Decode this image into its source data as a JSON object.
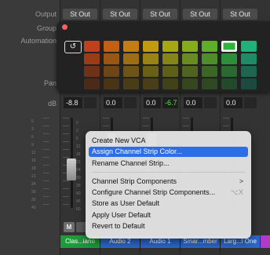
{
  "labels": {
    "output": "Output",
    "group": "Group",
    "automation": "Automation",
    "pan": "Pan",
    "db": "dB"
  },
  "strips": [
    {
      "output": "St Out",
      "db": "-8.8",
      "db2": "",
      "name": "Clas...iano",
      "color": "#1f9a3a",
      "mute": "M",
      "solo": ""
    },
    {
      "output": "St Out",
      "db": "0.0",
      "db2": "",
      "name": "Audio 2",
      "color": "#2c67c9"
    },
    {
      "output": "St Out",
      "db": "0.0",
      "db2": "-6.7",
      "name": "Audio 1",
      "color": "#2c67c9"
    },
    {
      "output": "St Out",
      "db": "0.0",
      "db2": "",
      "name": "Smar...mber",
      "color": "#2c67c9"
    },
    {
      "output": "St Out",
      "db": "0.0",
      "db2": "",
      "name": "Larg...l One",
      "color": "#2c67c9"
    }
  ],
  "palette": {
    "undo_icon": "↺",
    "rows": [
      [
        "#c0401c",
        "#c35e12",
        "#c57d12",
        "#c19a10",
        "#a6a712",
        "#87ac1c",
        "#5fae2a",
        "#2fb33a",
        "#1fb27a"
      ],
      [
        "#9a3c18",
        "#9c5612",
        "#9c6f14",
        "#978414",
        "#84861a",
        "#6a8a22",
        "#4f8c2c",
        "#2e8f3a",
        "#1f8c68"
      ],
      [
        "#6e3218",
        "#6e4514",
        "#6e5416",
        "#6a5f16",
        "#5e601a",
        "#4e6420",
        "#3c6626",
        "#2a6a32",
        "#1e6650"
      ],
      [
        "#4a2a18",
        "#4a3416",
        "#4a3c18",
        "#483f18",
        "#40421a",
        "#36461e",
        "#2e4822",
        "#24482a",
        "#1c4a3e"
      ]
    ],
    "selected": {
      "row": 0,
      "col": 7
    }
  },
  "menu": {
    "items": [
      {
        "label": "Create New VCA"
      },
      {
        "label": "Assign Channel Strip Color...",
        "highlighted": true
      },
      {
        "label": "Rename Channel Strip..."
      },
      {
        "label": "Channel Strip Components",
        "shortcut": ">"
      },
      {
        "label": "Configure Channel Strip Components...",
        "shortcut": "⌥X"
      },
      {
        "label": "Store as User Default"
      },
      {
        "label": "Apply User Default"
      },
      {
        "label": "Revert to Default"
      }
    ]
  },
  "scale_ticks": [
    "0",
    "3",
    "6",
    "9",
    "12",
    "15",
    "18",
    "21",
    "24",
    "30",
    "35",
    "40",
    "45",
    "50",
    "60"
  ]
}
